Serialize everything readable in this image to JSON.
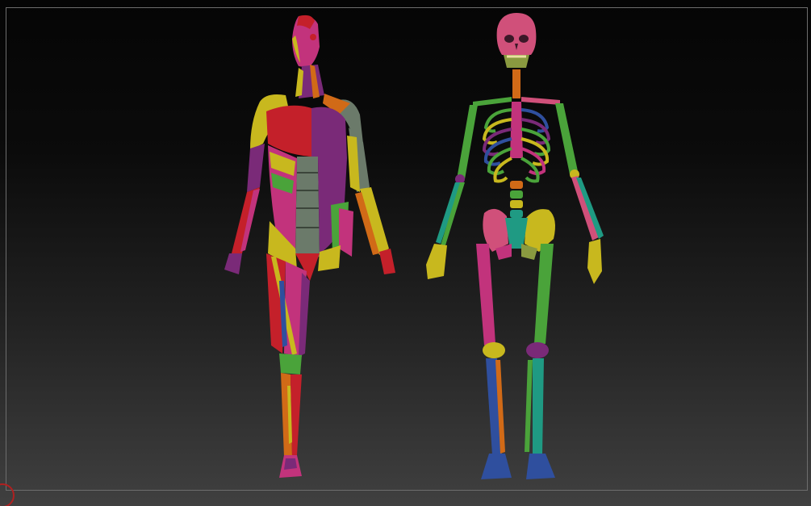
{
  "viewport": {
    "background_top": "#050505",
    "background_bottom": "#404040",
    "frame_color": "#6d6d6d"
  },
  "models": [
    {
      "name": "muscle-figure",
      "kind": "flayed anatomy model (ecorché)"
    },
    {
      "name": "skeleton-figure",
      "kind": "human skeleton model"
    }
  ],
  "palette": {
    "red": "#c4202a",
    "magenta": "#c2337c",
    "purple": "#7a2a78",
    "yellow": "#c8b81e",
    "orange": "#d16a17",
    "green": "#4aa33a",
    "teal": "#1f9a83",
    "blue": "#2f4f9e",
    "pink": "#d0507a",
    "olive": "#8a9a40",
    "gray": "#6b7a6a"
  },
  "icons": {
    "gizmo": "axis-gizmo-icon"
  }
}
